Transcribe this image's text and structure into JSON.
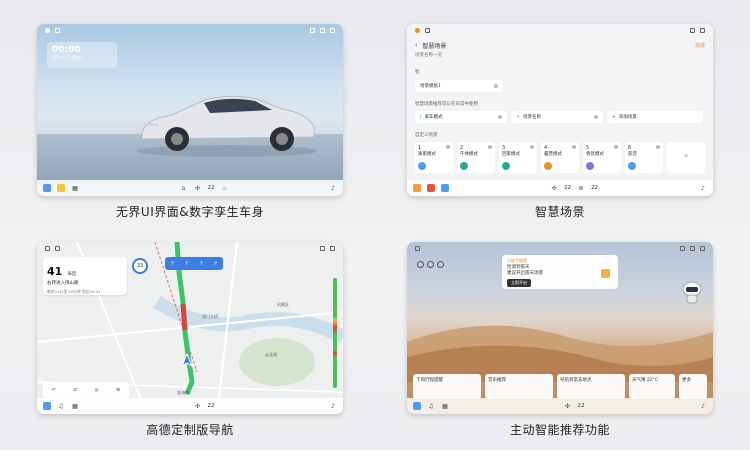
{
  "captions": [
    "无界UI界面&数字孪生车身",
    "智慧场景",
    "高德定制版导航",
    "主动智能推荐功能"
  ],
  "dock": {
    "temp_left": "22",
    "temp_right": "22"
  },
  "panel1": {
    "clock_time": "00:00",
    "clock_date": "16:00:00 星期六"
  },
  "panel2": {
    "title": "智慧场景",
    "done": "完成",
    "subtitle": "场景名称一览",
    "section1": "智",
    "pill_a": "场景模板1",
    "section2": "智慧场景推荐可以在日常中使用",
    "pill_b": "离车模式",
    "pill_c": "场景名称",
    "pill_d": "添加场景",
    "section3": "自定义场景",
    "tiles": [
      {
        "n": "1",
        "label": "离家模式"
      },
      {
        "n": "2",
        "label": "午休模式"
      },
      {
        "n": "3",
        "label": "回家模式"
      },
      {
        "n": "4",
        "label": "露营模式"
      },
      {
        "n": "5",
        "label": "香氛模式"
      },
      {
        "n": "6",
        "label": "影音"
      }
    ]
  },
  "panel3": {
    "distance": "41",
    "unit": "米后",
    "road": "右转进入佛山路",
    "info": "剩余21公里 40分钟 到达20:41",
    "speed": "33",
    "labels": [
      "龙门大桥",
      "云龙湖",
      "风景区",
      "淮海路"
    ]
  },
  "panel4": {
    "tag": "小助手推荐",
    "line1": "检测到雨天",
    "line2": "建议开启雨天场景",
    "btn": "立即开启",
    "cards": [
      "下周行程提醒",
      "音乐推荐",
      "导航到常去地点",
      "天气晴 22°C",
      "更多"
    ]
  },
  "colors": {
    "accent": "#e98d2c",
    "nav_blue": "#3b7fe6"
  }
}
